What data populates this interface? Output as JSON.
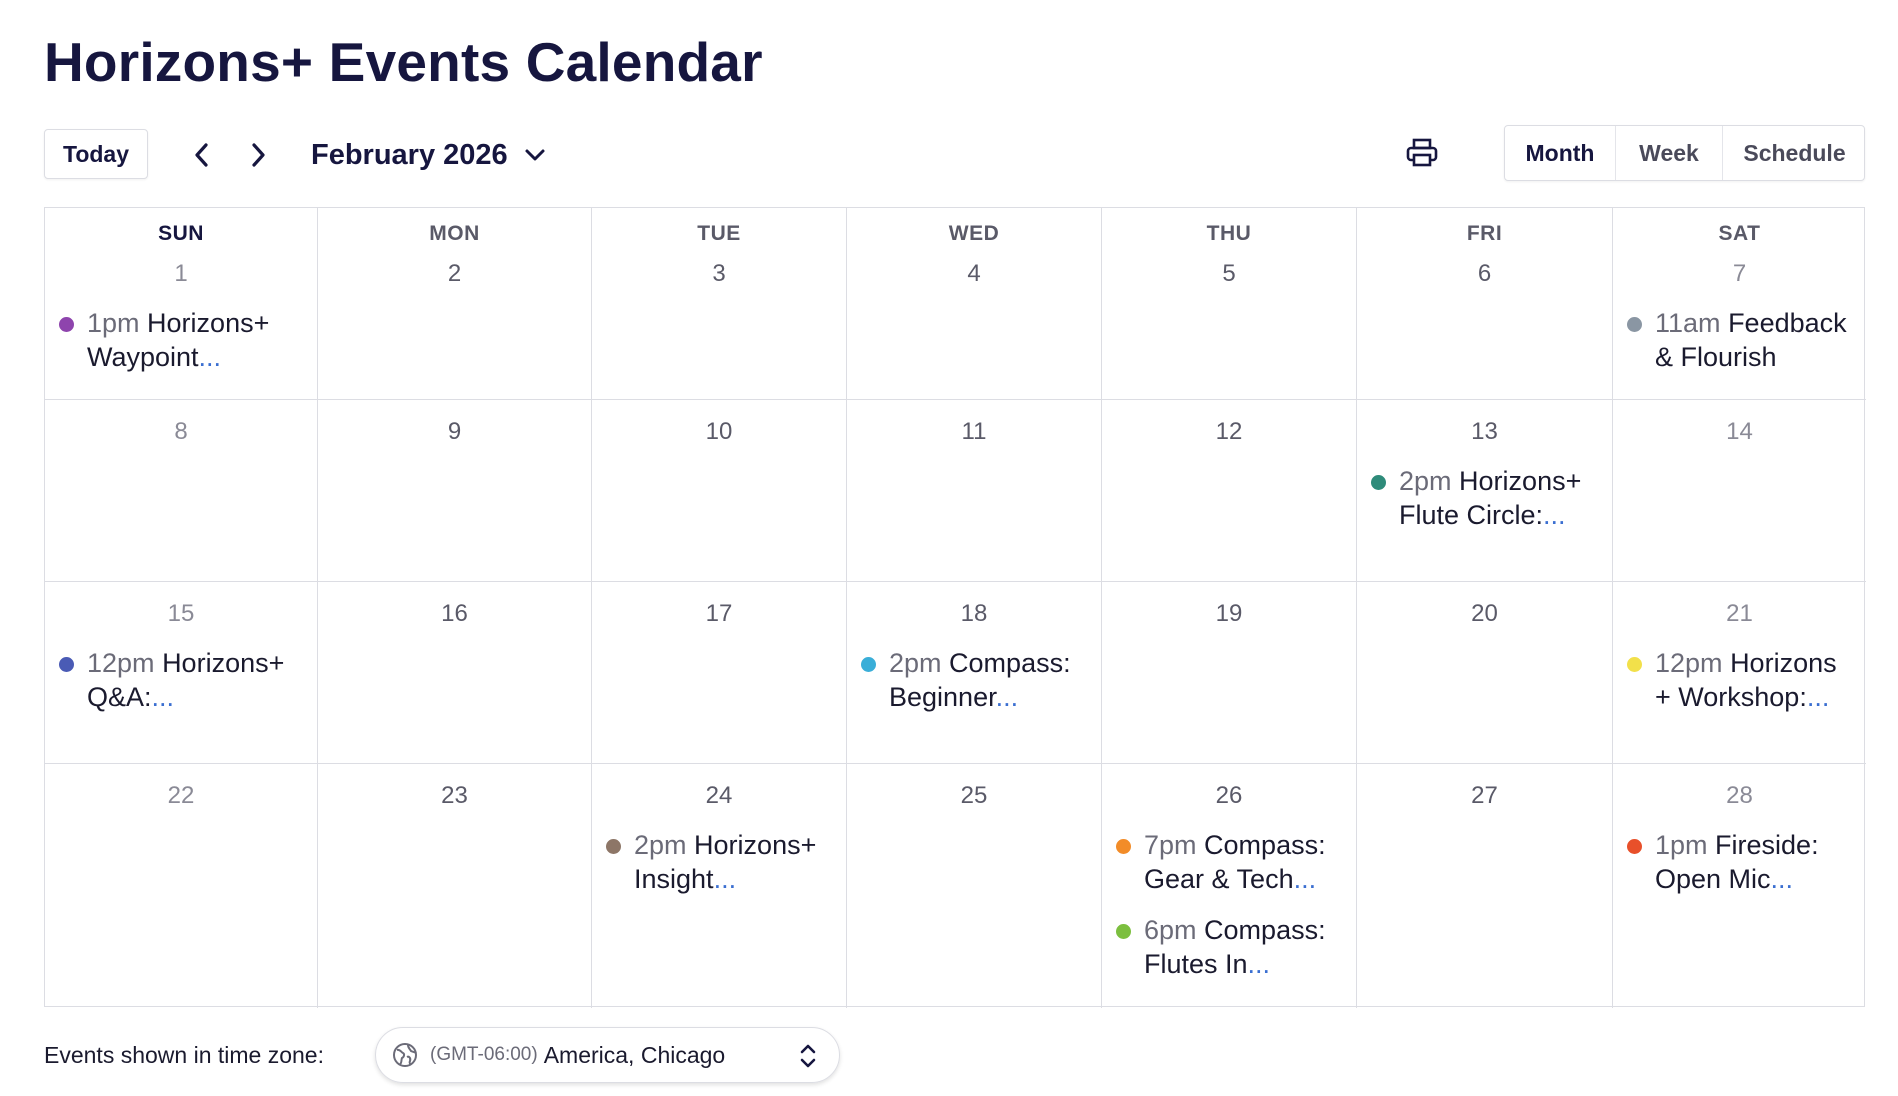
{
  "title": "Horizons+ Events Calendar",
  "toolbar": {
    "today_label": "Today",
    "month_label": "February 2026",
    "views": [
      "Month",
      "Week",
      "Schedule"
    ],
    "active_view": "Month"
  },
  "calendar": {
    "weekdays": [
      "SUN",
      "MON",
      "TUE",
      "WED",
      "THU",
      "FRI",
      "SAT"
    ],
    "weeks": [
      [
        {
          "day": "1",
          "events": [
            {
              "time": "1pm",
              "title": "Horizons+ Waypoint",
              "ellipsis": "...",
              "color": "#8e44ad"
            }
          ]
        },
        {
          "day": "2",
          "events": []
        },
        {
          "day": "3",
          "events": []
        },
        {
          "day": "4",
          "events": []
        },
        {
          "day": "5",
          "events": []
        },
        {
          "day": "6",
          "events": []
        },
        {
          "day": "7",
          "events": [
            {
              "time": "11am",
              "title": "Feedback & Flourish",
              "ellipsis": "",
              "color": "#8a96a3"
            }
          ]
        }
      ],
      [
        {
          "day": "8",
          "events": []
        },
        {
          "day": "9",
          "events": []
        },
        {
          "day": "10",
          "events": []
        },
        {
          "day": "11",
          "events": []
        },
        {
          "day": "12",
          "events": []
        },
        {
          "day": "13",
          "events": [
            {
              "time": "2pm",
              "title": "Horizons+ Flute Circle:",
              "ellipsis": "...",
              "color": "#2e8b7a"
            }
          ]
        },
        {
          "day": "14",
          "events": []
        }
      ],
      [
        {
          "day": "15",
          "events": [
            {
              "time": "12pm",
              "title": "Horizons+ Q&A:",
              "ellipsis": "...",
              "color": "#4a5bb5"
            }
          ]
        },
        {
          "day": "16",
          "events": []
        },
        {
          "day": "17",
          "events": []
        },
        {
          "day": "18",
          "events": [
            {
              "time": "2pm",
              "title": "Compass: Beginner",
              "ellipsis": "...",
              "color": "#3aaed8"
            }
          ]
        },
        {
          "day": "19",
          "events": []
        },
        {
          "day": "20",
          "events": []
        },
        {
          "day": "21",
          "events": [
            {
              "time": "12pm",
              "title": "Horizons + Workshop:",
              "ellipsis": "...",
              "color": "#f2e04a"
            }
          ]
        }
      ],
      [
        {
          "day": "22",
          "events": []
        },
        {
          "day": "23",
          "events": []
        },
        {
          "day": "24",
          "events": [
            {
              "time": "2pm",
              "title": "Horizons+ Insight",
              "ellipsis": "...",
              "color": "#8d7667"
            }
          ]
        },
        {
          "day": "25",
          "events": []
        },
        {
          "day": "26",
          "events": [
            {
              "time": "7pm",
              "title": "Compass: Gear & Tech",
              "ellipsis": "...",
              "color": "#f28c28"
            },
            {
              "time": "6pm",
              "title": "Compass: Flutes In",
              "ellipsis": "...",
              "color": "#7cbf3f"
            }
          ]
        },
        {
          "day": "27",
          "events": []
        },
        {
          "day": "28",
          "events": [
            {
              "time": "1pm",
              "title": "Fireside: Open Mic",
              "ellipsis": "...",
              "color": "#e8502a"
            }
          ]
        }
      ]
    ]
  },
  "timezone": {
    "label": "Events shown in time zone:",
    "offset": "(GMT-06:00)",
    "city": "America, Chicago"
  }
}
